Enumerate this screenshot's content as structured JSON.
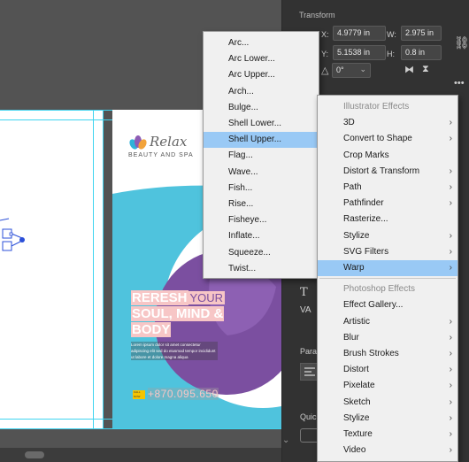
{
  "transform": {
    "title": "Transform",
    "x_label": "X:",
    "x_value": "4.9779 in",
    "y_label": "Y:",
    "y_value": "5.1538 in",
    "w_label": "W:",
    "w_value": "2.975 in",
    "h_label": "H:",
    "h_value": "0.8 in",
    "angle_value": "0°"
  },
  "panel_sections": {
    "paragraph_label": "Paragr",
    "quick_label": "Quick"
  },
  "brochure": {
    "logo_text": "Relax",
    "logo_sub": "BEAUTY AND SPA",
    "headline_1": "RERESH",
    "headline_1b": "YOUR",
    "headline_2": "SOUL, MIND &",
    "headline_3": "BODY",
    "body_text": "Lorem ipsum dolor sit amet consectetur adipiscing elit sed do eiusmod tempor incididunt ut labore et dolore magna aliqua",
    "phone": "+870.095.650",
    "phone_badge": "CALL NOW",
    "colors": {
      "cyan": "#4fc3dd",
      "purple": "#7b4fa0",
      "pink_text": "#f7c6c6",
      "accent": "#f5c400"
    }
  },
  "effects_menu": {
    "illustrator_header": "Illustrator Effects",
    "illustrator_items": [
      {
        "label": "3D",
        "arrow": "›"
      },
      {
        "label": "Convert to Shape",
        "arrow": "›"
      },
      {
        "label": "Crop Marks",
        "arrow": ""
      },
      {
        "label": "Distort & Transform",
        "arrow": "›"
      },
      {
        "label": "Path",
        "arrow": "›"
      },
      {
        "label": "Pathfinder",
        "arrow": "›"
      },
      {
        "label": "Rasterize...",
        "arrow": ""
      },
      {
        "label": "Stylize",
        "arrow": "›"
      },
      {
        "label": "SVG Filters",
        "arrow": "›"
      },
      {
        "label": "Warp",
        "arrow": "›"
      }
    ],
    "photoshop_header": "Photoshop Effects",
    "photoshop_items": [
      {
        "label": "Effect Gallery...",
        "arrow": ""
      },
      {
        "label": "Artistic",
        "arrow": "›"
      },
      {
        "label": "Blur",
        "arrow": "›"
      },
      {
        "label": "Brush Strokes",
        "arrow": "›"
      },
      {
        "label": "Distort",
        "arrow": "›"
      },
      {
        "label": "Pixelate",
        "arrow": "›"
      },
      {
        "label": "Sketch",
        "arrow": "›"
      },
      {
        "label": "Stylize",
        "arrow": "›"
      },
      {
        "label": "Texture",
        "arrow": "›"
      },
      {
        "label": "Video",
        "arrow": "›"
      }
    ]
  },
  "warp_menu": {
    "items": [
      "Arc...",
      "Arc Lower...",
      "Arc Upper...",
      "Arch...",
      "Bulge...",
      "Shell Lower...",
      "Shell Upper...",
      "Flag...",
      "Wave...",
      "Fish...",
      "Rise...",
      "Fisheye...",
      "Inflate...",
      "Squeeze...",
      "Twist..."
    ],
    "highlighted": "Shell Upper..."
  }
}
